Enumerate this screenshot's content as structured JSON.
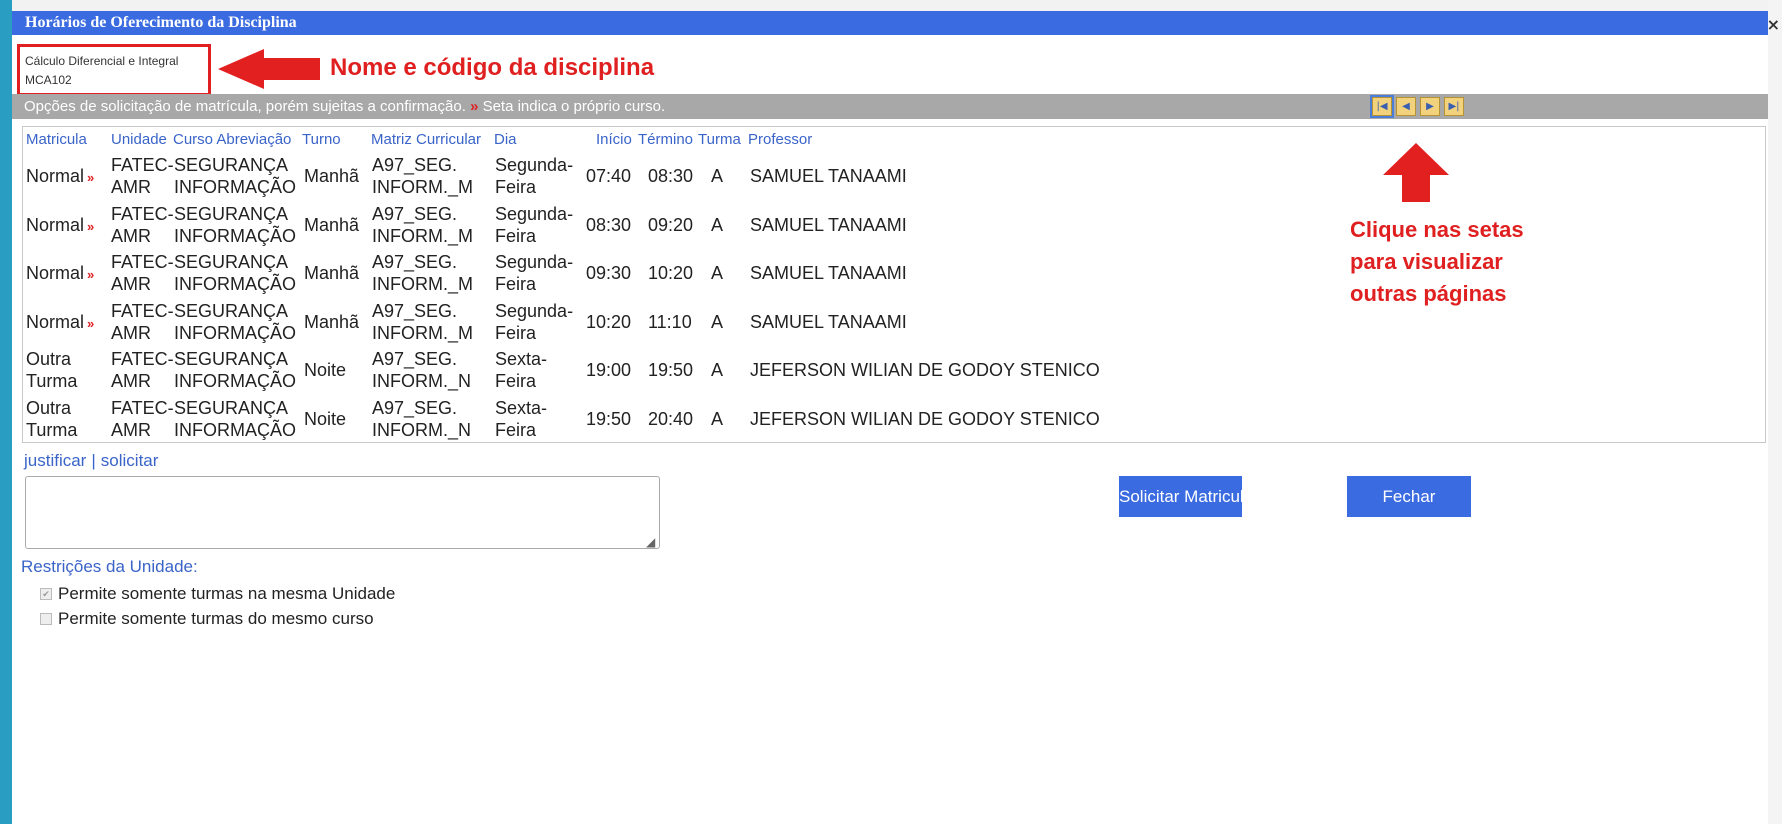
{
  "window": {
    "title": "Horários de Oferecimento da Disciplina",
    "close_glyph": "×"
  },
  "discipline": {
    "name": "Cálculo Diferencial e Integral",
    "code": "MCA102"
  },
  "annotations": {
    "name_code": "Nome e código da disciplina",
    "arrows_line1": "Clique nas setas",
    "arrows_line2": "para visualizar",
    "arrows_line3": "outras páginas",
    "color": "#e02020"
  },
  "info_bar": {
    "text": "Opções de solicitação de matrícula, porém sujeitas a confirmação.",
    "mark": "»",
    "mark_text": "Seta indica o próprio curso."
  },
  "pager": {
    "first": "first-page-icon",
    "prev": "prev-page-icon",
    "next": "next-page-icon",
    "last": "last-page-icon"
  },
  "table": {
    "headers": [
      "Matricula",
      "Unidade",
      "Curso Abreviação",
      "Turno",
      "Matriz Curricular",
      "Dia",
      "Início",
      "Término",
      "Turma",
      "Professor"
    ],
    "rows": [
      {
        "matricula": [
          "Normal"
        ],
        "own_course": true,
        "unidade": [
          "FATEC-",
          "AMR"
        ],
        "curso": [
          "SEGURANÇA",
          "INFORMAÇÃO"
        ],
        "turno": "Manhã",
        "matriz": [
          "A97_SEG.",
          "INFORM._M"
        ],
        "dia": [
          "Segunda-",
          "Feira"
        ],
        "inicio": "07:40",
        "termino": "08:30",
        "turma": "A",
        "professor": "SAMUEL TANAAMI"
      },
      {
        "matricula": [
          "Normal"
        ],
        "own_course": true,
        "unidade": [
          "FATEC-",
          "AMR"
        ],
        "curso": [
          "SEGURANÇA",
          "INFORMAÇÃO"
        ],
        "turno": "Manhã",
        "matriz": [
          "A97_SEG.",
          "INFORM._M"
        ],
        "dia": [
          "Segunda-",
          "Feira"
        ],
        "inicio": "08:30",
        "termino": "09:20",
        "turma": "A",
        "professor": "SAMUEL TANAAMI"
      },
      {
        "matricula": [
          "Normal"
        ],
        "own_course": true,
        "unidade": [
          "FATEC-",
          "AMR"
        ],
        "curso": [
          "SEGURANÇA",
          "INFORMAÇÃO"
        ],
        "turno": "Manhã",
        "matriz": [
          "A97_SEG.",
          "INFORM._M"
        ],
        "dia": [
          "Segunda-",
          "Feira"
        ],
        "inicio": "09:30",
        "termino": "10:20",
        "turma": "A",
        "professor": "SAMUEL TANAAMI"
      },
      {
        "matricula": [
          "Normal"
        ],
        "own_course": true,
        "unidade": [
          "FATEC-",
          "AMR"
        ],
        "curso": [
          "SEGURANÇA",
          "INFORMAÇÃO"
        ],
        "turno": "Manhã",
        "matriz": [
          "A97_SEG.",
          "INFORM._M"
        ],
        "dia": [
          "Segunda-",
          "Feira"
        ],
        "inicio": "10:20",
        "termino": "11:10",
        "turma": "A",
        "professor": "SAMUEL TANAAMI"
      },
      {
        "matricula": [
          "Outra",
          "Turma"
        ],
        "own_course": false,
        "unidade": [
          "FATEC-",
          "AMR"
        ],
        "curso": [
          "SEGURANÇA",
          "INFORMAÇÃO"
        ],
        "turno": "Noite",
        "matriz": [
          "A97_SEG.",
          "INFORM._N"
        ],
        "dia": [
          "Sexta-",
          "Feira"
        ],
        "inicio": "19:00",
        "termino": "19:50",
        "turma": "A",
        "professor": "JEFERSON WILIAN DE GODOY STENICO"
      },
      {
        "matricula": [
          "Outra",
          "Turma"
        ],
        "own_course": false,
        "unidade": [
          "FATEC-",
          "AMR"
        ],
        "curso": [
          "SEGURANÇA",
          "INFORMAÇÃO"
        ],
        "turno": "Noite",
        "matriz": [
          "A97_SEG.",
          "INFORM._N"
        ],
        "dia": [
          "Sexta-",
          "Feira"
        ],
        "inicio": "19:50",
        "termino": "20:40",
        "turma": "A",
        "professor": "JEFERSON WILIAN DE GODOY STENICO"
      }
    ]
  },
  "links": {
    "justificar": "justificar",
    "separator": "|",
    "solicitar": "solicitar"
  },
  "textarea": {
    "value": ""
  },
  "buttons": {
    "solicitar": "Solicitar Matricula",
    "fechar": "Fechar"
  },
  "restrictions": {
    "title": "Restrições da Unidade:",
    "items": [
      {
        "label": "Permite somente turmas na mesma Unidade",
        "checked": true
      },
      {
        "label": "Permite somente turmas do mesmo curso",
        "checked": false
      }
    ]
  },
  "colors": {
    "titlebar": "#3a6be0",
    "info_bar": "#a8a8a8",
    "header_text": "#3a64c8",
    "accent_red": "#e02020"
  }
}
